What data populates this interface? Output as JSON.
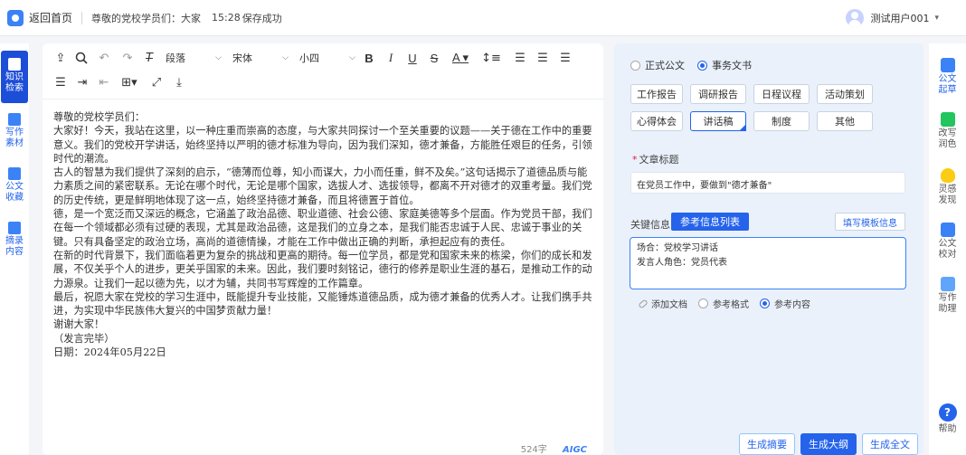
{
  "topbar": {
    "back_label": "返回首页",
    "doc_title": "尊敬的党校学员们：大家",
    "save_time": "15:28",
    "save_status": "保存成功",
    "username": "测试用户001"
  },
  "left_nav": [
    {
      "label1": "知识",
      "label2": "检索",
      "icon": "knowledge-search-icon",
      "active": true
    },
    {
      "label1": "写作",
      "label2": "素材",
      "icon": "writing-material-icon",
      "active": false
    },
    {
      "label1": "公文",
      "label2": "收藏",
      "icon": "doc-favorite-icon",
      "active": false
    },
    {
      "label1": "摘录",
      "label2": "内容",
      "icon": "excerpt-icon",
      "active": false
    }
  ],
  "toolbar": {
    "paragraph_select": "段落",
    "font_select": "宋体",
    "size_select": "小四",
    "icons": [
      "upload-icon",
      "search-icon",
      "undo-icon",
      "redo-icon",
      "clear-format-icon",
      "bold-icon",
      "italic-icon",
      "underline-icon",
      "strikethrough-icon",
      "font-color-icon",
      "line-height-icon",
      "align-left-icon",
      "align-center-icon",
      "align-right-icon",
      "justify-icon",
      "indent-icon",
      "outdent-icon",
      "table-icon",
      "fullscreen-icon",
      "download-icon"
    ]
  },
  "document": {
    "paragraphs": [
      "尊敬的党校学员们：",
      "大家好！今天，我站在这里，以一种庄重而崇高的态度，与大家共同探讨一个至关重要的议题——关于德在工作中的重要意义。我们的党校开学讲话，始终坚持以严明的德才标准为导向，因为我们深知，德才兼备，方能胜任艰巨的任务，引领时代的潮流。",
      "古人的智慧为我们提供了深刻的启示，“德薄而位尊，知小而谋大，力小而任重，鲜不及矣。”这句话揭示了道德品质与能力素质之间的紧密联系。无论在哪个时代，无论是哪个国家，选拔人才、选拔领导，都离不开对德才的双重考量。我们党的历史传统，更是鲜明地体现了这一点，始终坚持德才兼备，而且将德置于首位。",
      "德，是一个宽泛而又深远的概念，它涵盖了政治品德、职业道德、社会公德、家庭美德等多个层面。作为党员干部，我们在每一个领域都必须有过硬的表现，尤其是政治品德，这是我们的立身之本，是我们能否忠诚于人民、忠诚于事业的关键。只有具备坚定的政治立场，高尚的道德情操，才能在工作中做出正确的判断，承担起应有的责任。",
      "在新的时代背景下，我们面临着更为复杂的挑战和更高的期待。每一位学员，都是党和国家未来的栋梁，你们的成长和发展，不仅关乎个人的进步，更关乎国家的未来。因此，我们要时刻铭记，德行的修养是职业生涯的基石，是推动工作的动力源泉。让我们一起以德为先，以才为辅，共同书写辉煌的工作篇章。",
      "最后，祝愿大家在党校的学习生涯中，既能提升专业技能，又能锤炼道德品质，成为德才兼备的优秀人才。让我们携手共进，为实现中华民族伟大复兴的中国梦贡献力量！",
      "谢谢大家！",
      "（发言完毕）",
      "日期：2024年05月22日"
    ],
    "word_count": "524字",
    "aigc_label": "AIGC"
  },
  "panel": {
    "doc_types": [
      {
        "label": "正式公文",
        "selected": false
      },
      {
        "label": "事务文书",
        "selected": true
      }
    ],
    "categories": [
      "工作报告",
      "调研报告",
      "日程议程",
      "活动策划",
      "心得体会",
      "讲话稿",
      "制度",
      "其他"
    ],
    "selected_category": "讲话稿",
    "title_label": "文章标题",
    "title_value": "在党员工作中，要做到\"德才兼备\"",
    "key_info_label": "关键信息",
    "ref_tab_label": "参考信息列表",
    "fill_template_label": "填写模板信息",
    "key_info_lines": [
      "场合：党校学习讲话",
      "发言人角色：党员代表"
    ],
    "options": [
      {
        "label": "添加文档"
      },
      {
        "label": "参考格式",
        "selected": false
      },
      {
        "label": "参考内容",
        "selected": true
      }
    ],
    "buttons": {
      "summary": "生成摘要",
      "outline": "生成大纲",
      "fulltext": "生成全文"
    }
  },
  "right_rail": [
    {
      "label1": "公文",
      "label2": "起草",
      "icon": "doc-draft-icon",
      "active": true
    },
    {
      "label1": "改写",
      "label2": "润色",
      "icon": "rewrite-icon",
      "active": false
    },
    {
      "label1": "灵感",
      "label2": "发现",
      "icon": "lightbulb-icon",
      "active": false
    },
    {
      "label1": "公文",
      "label2": "校对",
      "icon": "proofread-icon",
      "active": false
    },
    {
      "label1": "写作",
      "label2": "助理",
      "icon": "ai-assistant-icon",
      "active": false
    }
  ],
  "help_label": "帮助"
}
